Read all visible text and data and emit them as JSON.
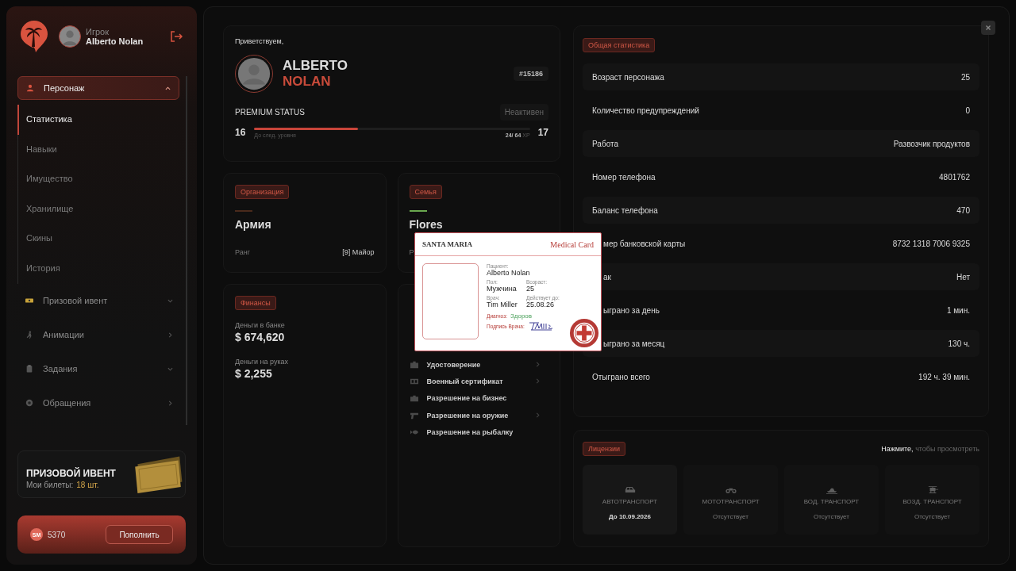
{
  "sidebar": {
    "player_label": "Игрок",
    "player_name": "Alberto Nolan",
    "menu": [
      {
        "label": "Персонаж",
        "kind": "person",
        "expanded": true,
        "children": [
          {
            "label": "Статистика",
            "selected": true
          },
          {
            "label": "Навыки",
            "selected": false
          },
          {
            "label": "Имущество",
            "selected": false
          },
          {
            "label": "Хранилище",
            "selected": false
          },
          {
            "label": "Скины",
            "selected": false
          },
          {
            "label": "История",
            "selected": false
          }
        ]
      },
      {
        "label": "Призовой ивент",
        "kind": "ticket",
        "expandable": true,
        "expanded": false
      },
      {
        "label": "Анимации",
        "kind": "animation",
        "expandable": false,
        "expanded": false
      },
      {
        "label": "Задания",
        "kind": "tasks",
        "expandable": true,
        "expanded": false
      },
      {
        "label": "Обращения",
        "kind": "support",
        "expandable": false,
        "expanded": false
      }
    ],
    "prize": {
      "title": "ПРИЗОВОЙ ИВЕНТ",
      "tickets_label": "Мои билеты:",
      "tickets_value": "18 шт."
    },
    "balance": {
      "coin": "SM",
      "amount": "5370",
      "button": "Пополнить"
    }
  },
  "profile": {
    "greeting": "Приветствуем,",
    "first_name": "ALBERTO",
    "last_name": "NOLAN",
    "id": "#15186",
    "premium_label": "PREMIUM STATUS",
    "premium_status": "Неактивен",
    "level_current": "16",
    "level_next": "17",
    "level_caption": "До след. уровня",
    "xp": "24/ 64",
    "xp_unit": "XP",
    "level": 0.375
  },
  "groups": [
    {
      "badge": "Организация",
      "color": "#4a2a1c",
      "name": "Армия",
      "rank_label": "Ранг",
      "rank_value": "[9] Майор"
    },
    {
      "badge": "Семья",
      "color": "#6aa84f",
      "name": "Flores",
      "rank_label": "Р"
    }
  ],
  "finances": {
    "badge": "Финансы",
    "items": [
      {
        "label": "Деньги в банке",
        "value": "$ 674,620"
      },
      {
        "label": "Деньги на руках",
        "value": "$ 2,255"
      }
    ]
  },
  "documents": [
    {
      "label": "Удостоверение",
      "kind": "id",
      "has_arrow": true
    },
    {
      "label": "Военный сертификат",
      "kind": "military",
      "has_arrow": true
    },
    {
      "label": "Разрешение на бизнес",
      "kind": "business",
      "has_arrow": false
    },
    {
      "label": "Разрешение на оружие",
      "kind": "gun",
      "has_arrow": true
    },
    {
      "label": "Разрешение на рыбалку",
      "kind": "fish",
      "has_arrow": false
    }
  ],
  "stats": {
    "badge": "Общая статистика",
    "rows": [
      {
        "label": "Возраст персонажа",
        "value": "25",
        "kind": "full"
      },
      {
        "label": "Количество предупреждений",
        "value": "0",
        "kind": "full"
      },
      {
        "label": "Работа",
        "value": "Развозчик продуктов",
        "kind": "full"
      },
      {
        "label": "Номер телефона",
        "value": "4801762",
        "kind": "full"
      },
      {
        "label": "Баланс телефона",
        "value": "470",
        "kind": "full"
      },
      {
        "label": "мер банковской карты",
        "value": "8732 1318 7006 9325",
        "kind": "partial"
      },
      {
        "label": "ак",
        "value": "Нет",
        "kind": "partial"
      },
      {
        "label": "ыграно за день",
        "value": "1 мин.",
        "kind": "partial"
      },
      {
        "label": "ыграно за месяц",
        "value": "130 ч.",
        "kind": "partial"
      },
      {
        "label": "Отыграно всего",
        "value": "192 ч. 39 мин.",
        "kind": "full"
      }
    ]
  },
  "licenses": {
    "badge": "Лицензии",
    "hint": "**Нажмите,** чтобы просмотреть",
    "items": [
      {
        "label": "АВТОТРАНСПОРТ",
        "status": "До 10.09.2026",
        "kind": "car",
        "active": true
      },
      {
        "label": "МОТОТРАНСПОРТ",
        "status": "Отсутствует",
        "kind": "moto",
        "active": false
      },
      {
        "label": "ВОД. ТРАНСПОРТ",
        "status": "Отсутствует",
        "kind": "boat",
        "active": false
      },
      {
        "label": "ВОЗД. ТРАНСПОРТ",
        "status": "Отсутствует",
        "kind": "heli",
        "active": false
      }
    ]
  },
  "medical_card": {
    "org": "SANTA MARIA",
    "title": "Medical Card",
    "patient_label": "Пациент:",
    "patient": "Alberto Nolan",
    "sex_label": "Пол:",
    "sex": "Мужчина",
    "age_label": "Возраст:",
    "age": "25",
    "doctor_label": "Врач:",
    "doctor": "Tim Miller",
    "valid_label": "Действует до:",
    "valid": "25.08.26",
    "diagnosis_label": "Диагноз:",
    "diagnosis": "Здоров",
    "signature_label": "Подпись Врача:"
  }
}
